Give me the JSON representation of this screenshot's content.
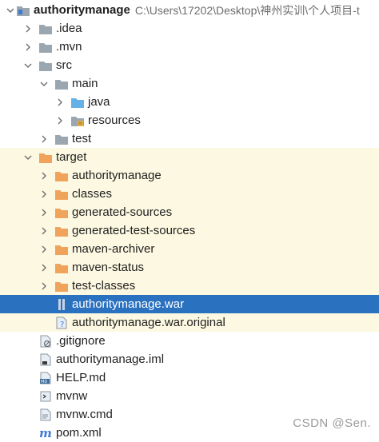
{
  "project": {
    "name": "authoritymanage",
    "path": "C:\\Users\\17202\\Desktop\\神州实训\\个人项目-t"
  },
  "items": {
    "idea": ".idea",
    "mvn": ".mvn",
    "src": "src",
    "main": "main",
    "java": "java",
    "resources": "resources",
    "test": "test",
    "target": "target",
    "t_authoritymanage": "authoritymanage",
    "t_classes": "classes",
    "t_generated_sources": "generated-sources",
    "t_generated_test_sources": "generated-test-sources",
    "t_maven_archiver": "maven-archiver",
    "t_maven_status": "maven-status",
    "t_test_classes": "test-classes",
    "t_war": "authoritymanage.war",
    "t_war_original": "authoritymanage.war.original",
    "gitignore": ".gitignore",
    "iml": "authoritymanage.iml",
    "help": "HELP.md",
    "mvnw": "mvnw",
    "mvnw_cmd": "mvnw.cmd",
    "pom": "pom.xml"
  },
  "watermark": "CSDN @Sen.",
  "colors": {
    "selection": "#2a71c0",
    "excluded_bg": "#fcf8e1",
    "folder_gray": "#9aa7b0",
    "folder_orange": "#f0a35b",
    "folder_blue": "#66b0e8"
  }
}
